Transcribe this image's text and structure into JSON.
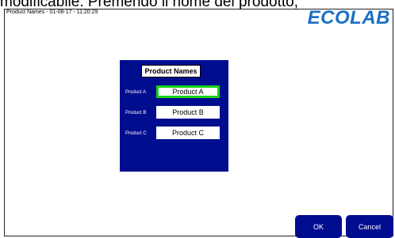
{
  "overlay_caption": "modificabile. Premendo il nome del prodotto,",
  "header": {
    "status": "Product Names - 01-08-17 - 11:20:29",
    "logo_text": "ECOLAB"
  },
  "dialog": {
    "title": "Product Names",
    "rows": [
      {
        "label": "Product A",
        "value": "Product A",
        "active": true
      },
      {
        "label": "Product B",
        "value": "Product B",
        "active": false
      },
      {
        "label": "Product C",
        "value": "Product C",
        "active": false
      }
    ]
  },
  "buttons": {
    "ok": "OK",
    "cancel": "Cancel"
  },
  "colors": {
    "panel": "#000d8f",
    "active_border": "#18d21a",
    "logo": "#1a6fc2"
  }
}
